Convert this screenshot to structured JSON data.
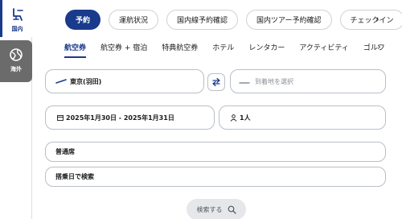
{
  "side_tabs": [
    {
      "label": "国内",
      "icon": "domestic-flight-seat-icon"
    },
    {
      "label": "海外",
      "icon": "globe-icon"
    }
  ],
  "pills": [
    "予約",
    "運航状況",
    "国内線予約確認",
    "国内ツアー予約確認",
    "チェックイン"
  ],
  "tabs": [
    "航空券",
    "航空券 + 宿泊",
    "特典航空券",
    "ホテル",
    "レンタカー",
    "アクティビティ",
    "ゴルフ"
  ],
  "form": {
    "origin": "東京(羽田)",
    "destination_placeholder": "到着地を選択",
    "dates": "2025年1月30日 - 2025年1月31日",
    "passengers": "1人",
    "seat_class": "普通席",
    "search_by": "搭乗日で検索"
  },
  "search_button": "検索する",
  "colors": {
    "accent": "#1a3a8c",
    "border": "#b9bfc7",
    "intl_tab": "#6b6b6b"
  }
}
